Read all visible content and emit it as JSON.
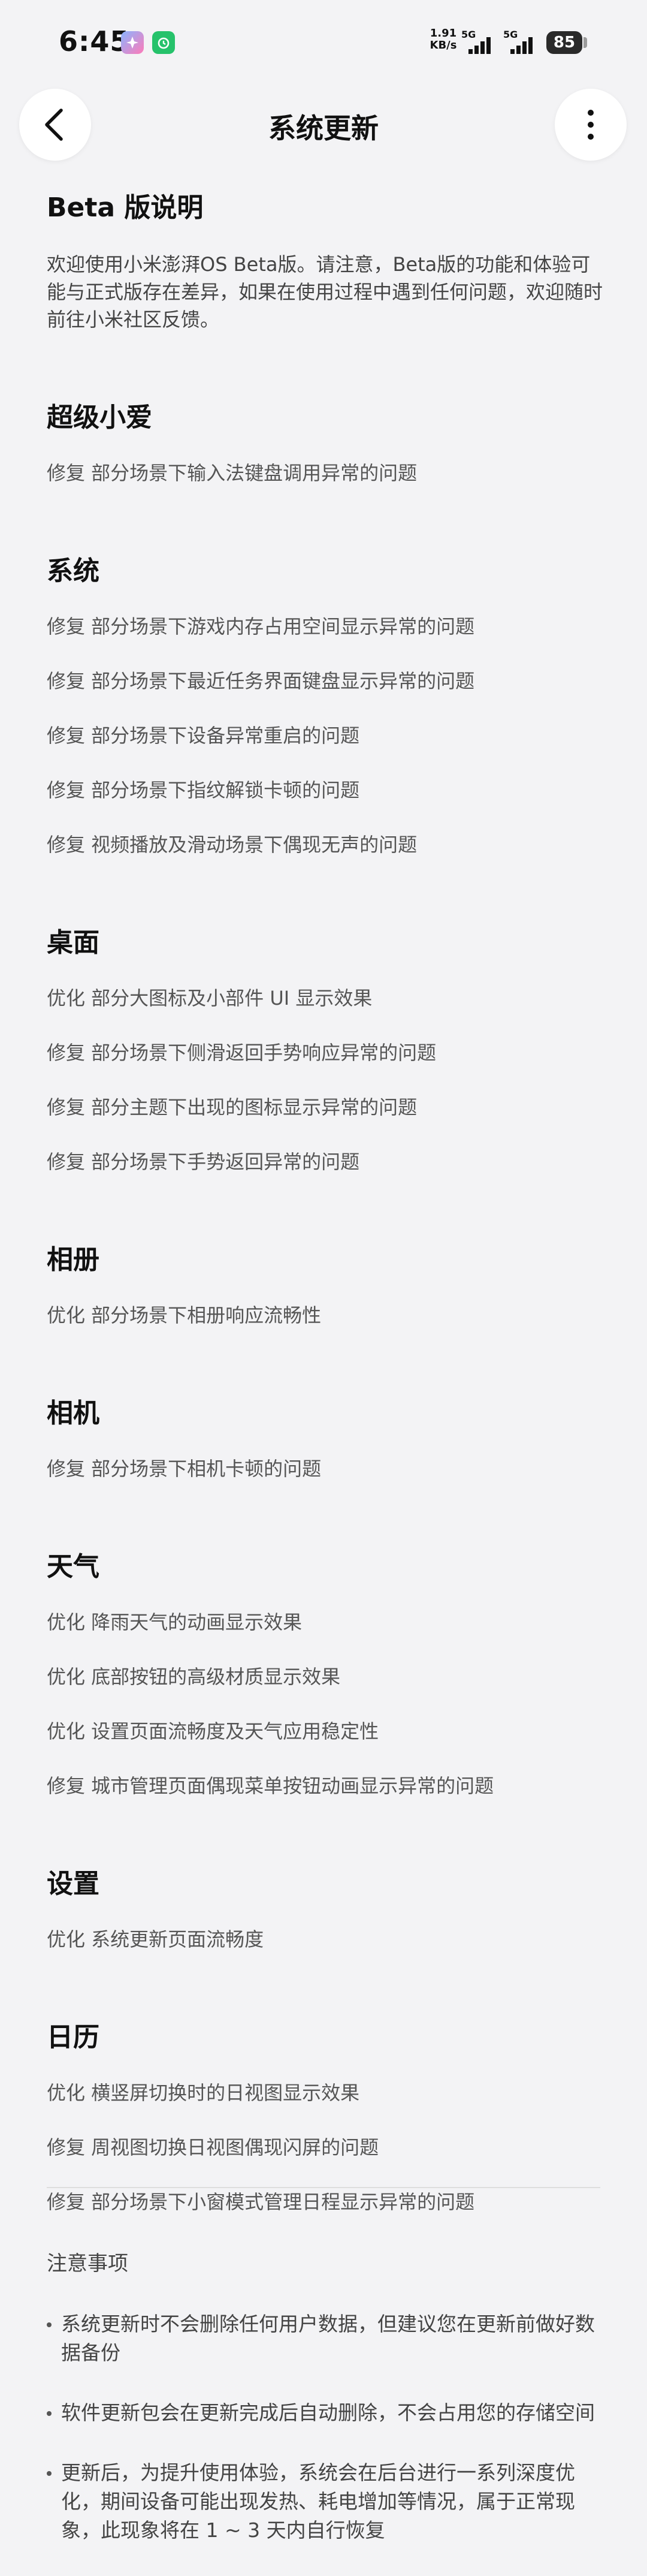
{
  "status_bar": {
    "time": "6:45",
    "net_speed_value": "1.91",
    "net_speed_unit": "KB/s",
    "signal_1": "5G",
    "signal_2": "5G",
    "battery": "85"
  },
  "header": {
    "title": "系统更新",
    "back_icon": "back-arrow-icon",
    "more_icon": "more-vertical-icon"
  },
  "beta": {
    "title": "Beta 版说明",
    "description": "欢迎使用小米澎湃OS Beta版。请注意，Beta版的功能和体验可能与正式版存在差异，如果在使用过程中遇到任何问题，欢迎随时前往小米社区反馈。"
  },
  "sections": [
    {
      "title": "超级小爱",
      "items": [
        "修复 部分场景下输入法键盘调用异常的问题"
      ]
    },
    {
      "title": "系统",
      "items": [
        "修复 部分场景下游戏内存占用空间显示异常的问题",
        "修复 部分场景下最近任务界面键盘显示异常的问题",
        "修复 部分场景下设备异常重启的问题",
        "修复 部分场景下指纹解锁卡顿的问题",
        "修复 视频播放及滑动场景下偶现无声的问题"
      ]
    },
    {
      "title": "桌面",
      "items": [
        "优化 部分大图标及小部件 UI 显示效果",
        "修复 部分场景下侧滑返回手势响应异常的问题",
        "修复 部分主题下出现的图标显示异常的问题",
        "修复 部分场景下手势返回异常的问题"
      ]
    },
    {
      "title": "相册",
      "items": [
        "优化 部分场景下相册响应流畅性"
      ]
    },
    {
      "title": "相机",
      "items": [
        "修复 部分场景下相机卡顿的问题"
      ]
    },
    {
      "title": "天气",
      "items": [
        "优化 降雨天气的动画显示效果",
        "优化 底部按钮的高级材质显示效果",
        "优化 设置页面流畅度及天气应用稳定性",
        "修复 城市管理页面偶现菜单按钮动画显示异常的问题"
      ]
    },
    {
      "title": "设置",
      "items": [
        "优化 系统更新页面流畅度"
      ]
    },
    {
      "title": "日历",
      "items": [
        "优化 横竖屏切换时的日视图显示效果",
        "修复 周视图切换日视图偶现闪屏的问题",
        "修复 部分场景下小窗模式管理日程显示异常的问题"
      ]
    }
  ],
  "notes": {
    "title": "注意事项",
    "items": [
      "系统更新时不会删除任何用户数据，但建议您在更新前做好数据备份",
      "软件更新包会在更新完成后自动删除，不会占用您的存储空间",
      "更新后，为提升使用体验，系统会在后台进行一系列深度优化，期间设备可能出现发热、耗电增加等情况，属于正常现象，此现象将在 1 ~ 3 天内自行恢复"
    ]
  }
}
